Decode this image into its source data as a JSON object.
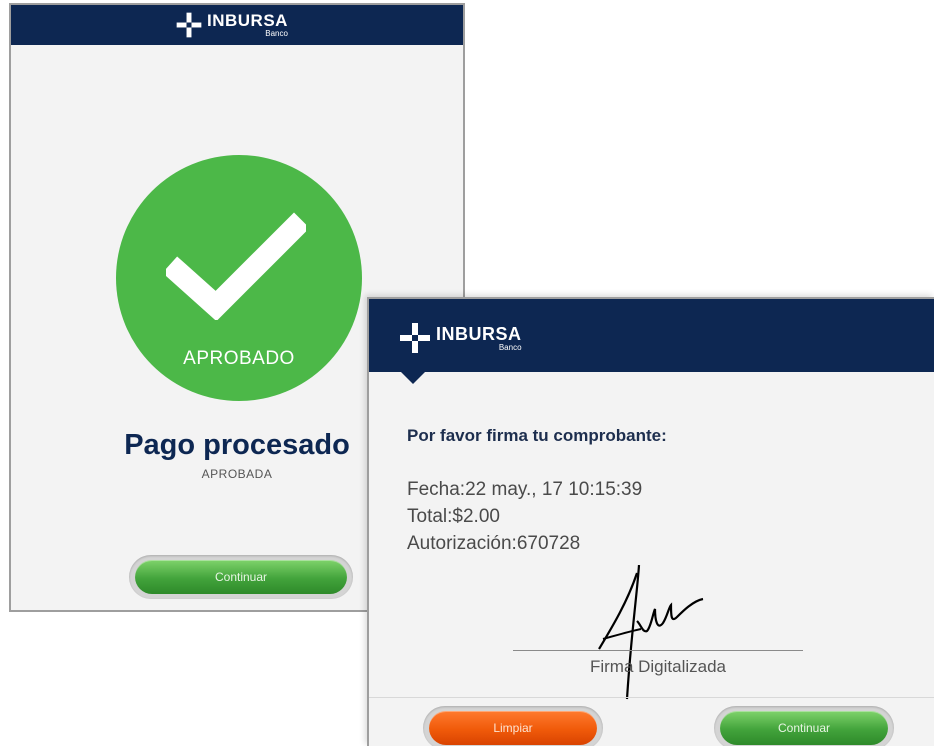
{
  "brand": {
    "name": "INBURSA",
    "sub": "Banco",
    "colors": {
      "header": "#0d2752",
      "approved_green": "#4cb848",
      "button_green": "#42a33b",
      "button_orange": "#f05a0a"
    },
    "logo_icon": "inbursa-logo-icon"
  },
  "approved_screen": {
    "status_icon": "check-mark-icon",
    "status_label": "APROBADO",
    "title": "Pago procesado",
    "subtitle": "APROBADA",
    "continue_label": "Continuar"
  },
  "signature_screen": {
    "prompt": "Por favor firma tu comprobante:",
    "fecha": "Fecha:22 may., 17  10:15:39",
    "total": "Total:$2.00",
    "autorizacion": "Autorización:670728",
    "signature_caption": "Firma Digitalizada",
    "clear_label": "Limpiar",
    "continue_label": "Continuar"
  }
}
